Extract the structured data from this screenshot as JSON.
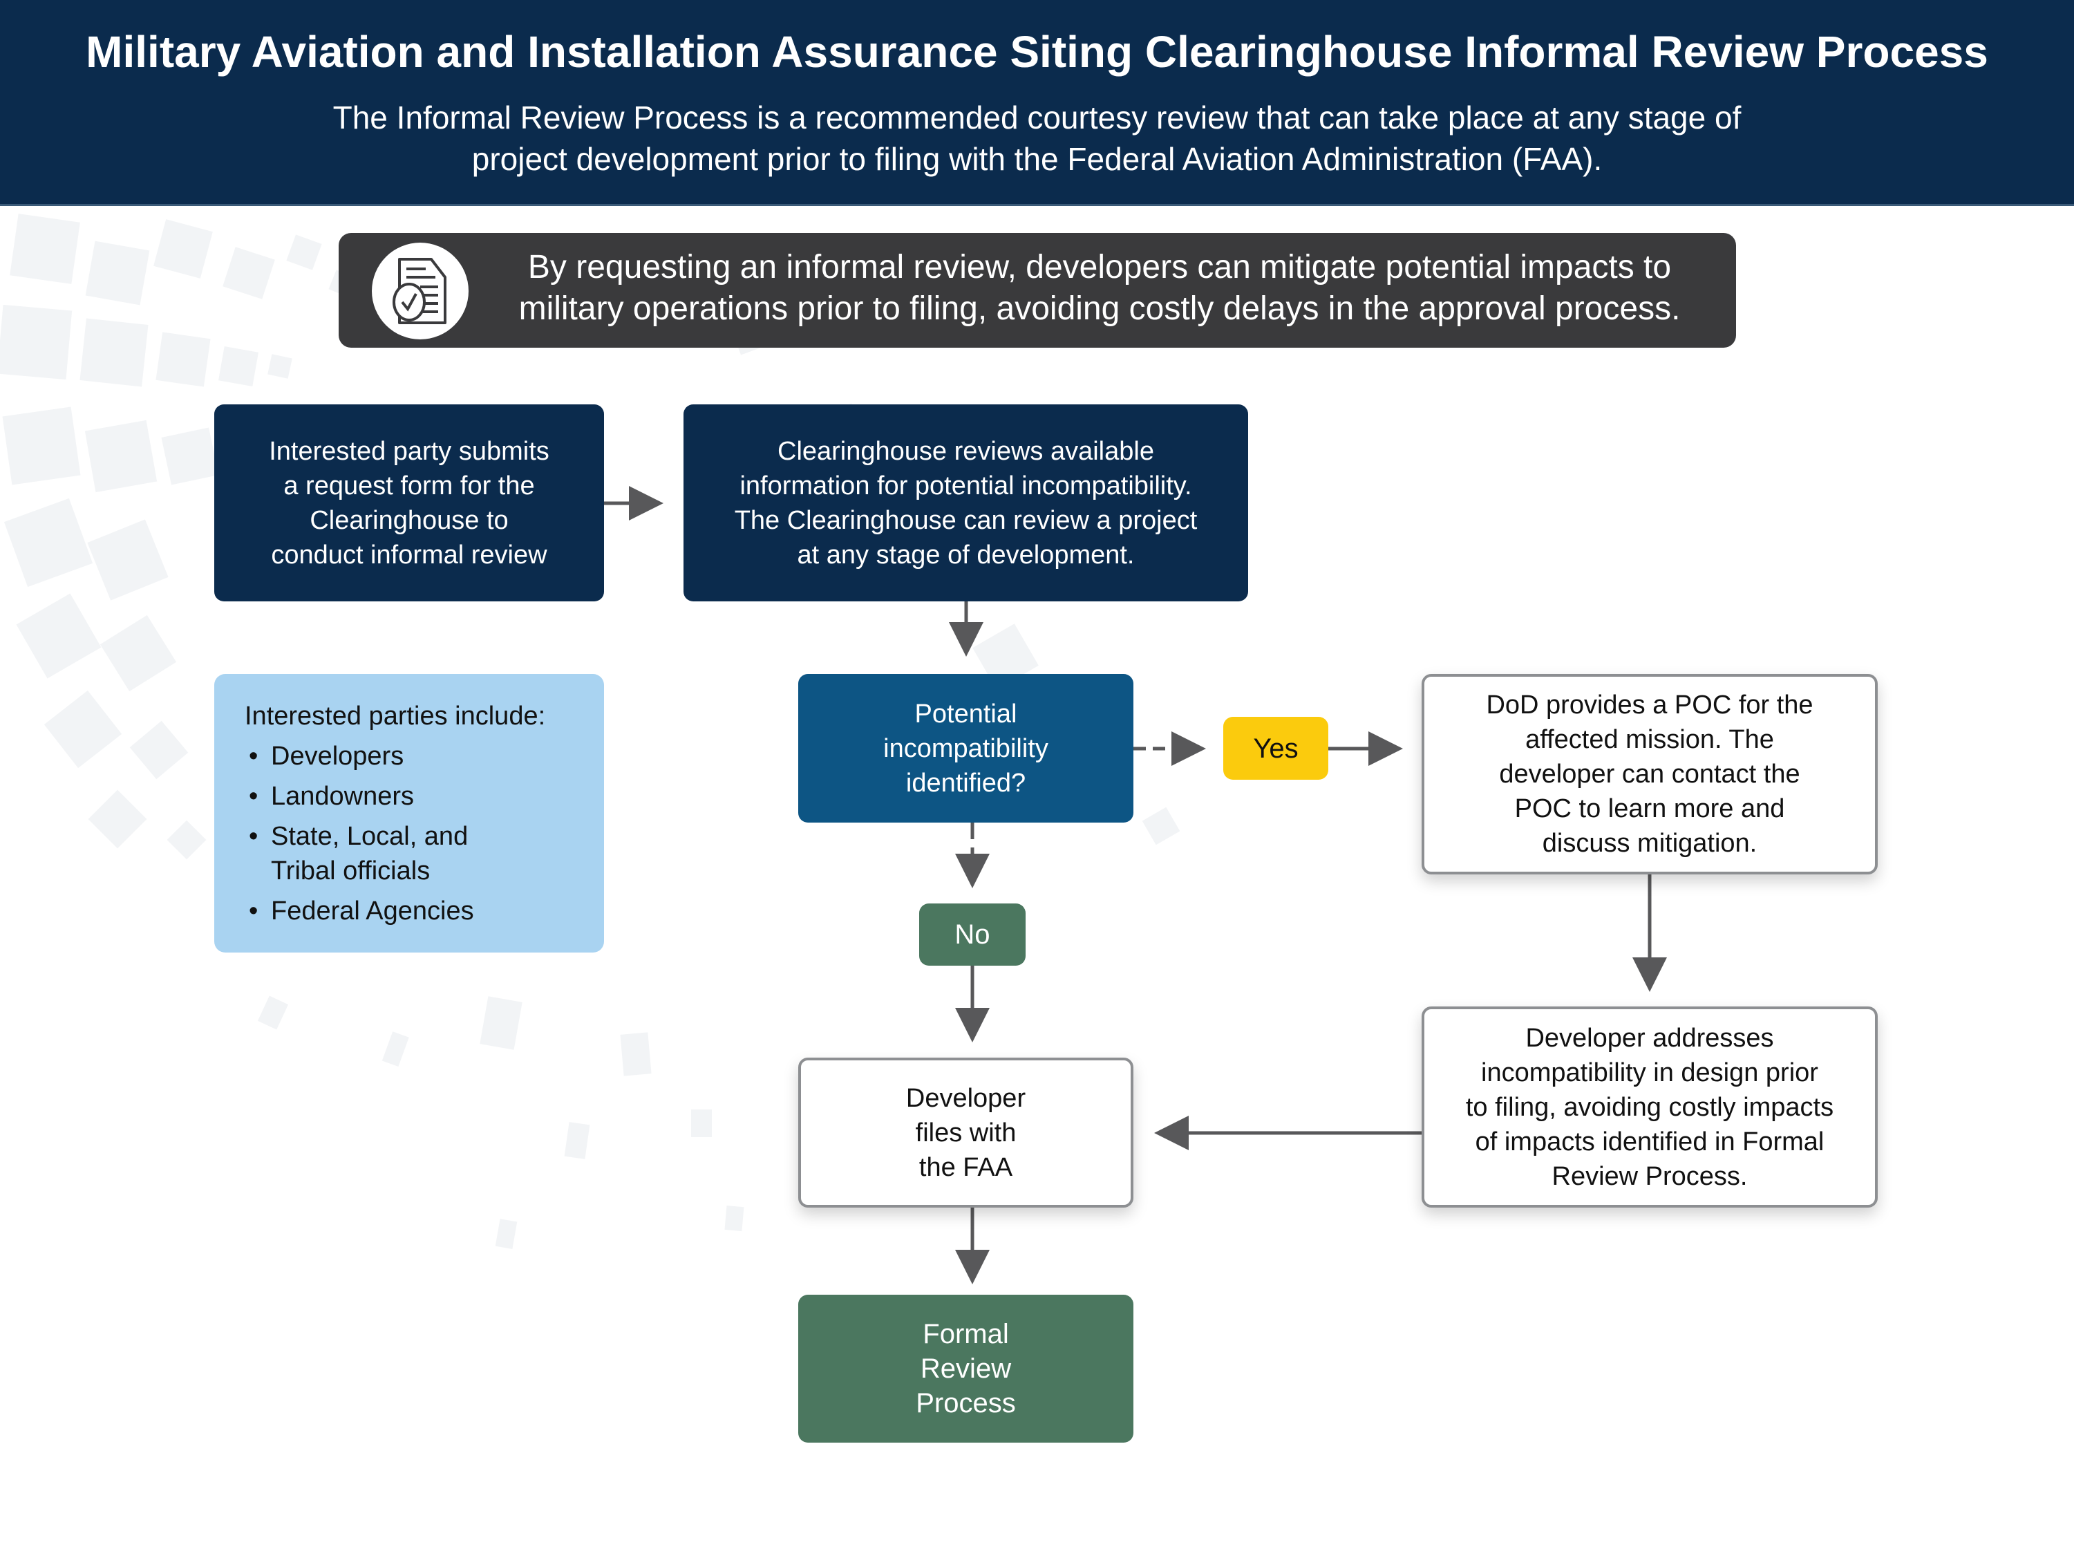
{
  "header": {
    "title": "Military Aviation and Installation Assurance Siting Clearinghouse Informal Review Process",
    "subtitle_line1": "The Informal Review Process is a recommended courtesy review that can take place at any stage of",
    "subtitle_line2": "project development prior to filing with the Federal Aviation Administration (FAA)."
  },
  "callout": {
    "icon": "document-checkmark-icon",
    "line1": "By requesting an informal review, developers can mitigate potential impacts to",
    "line2": "military operations prior to filing, avoiding costly delays in the approval process."
  },
  "flow": {
    "submit_request": [
      "Interested party submits",
      "a request form for the",
      "Clearinghouse to",
      "conduct informal review"
    ],
    "clearinghouse_reviews": [
      "Clearinghouse reviews available",
      "information for potential incompatibility.",
      "The Clearinghouse can review a project",
      "at any stage of development."
    ],
    "interested_parties": {
      "heading": "Interested parties include:",
      "items": [
        {
          "line1": "Developers"
        },
        {
          "line1": "Landowners"
        },
        {
          "line1": "State, Local, and",
          "line2": "Tribal officials"
        },
        {
          "line1": "Federal Agencies"
        }
      ],
      "bullet": "•"
    },
    "decision": [
      "Potential",
      "incompatibility",
      "identified?"
    ],
    "yes_label": "Yes",
    "no_label": "No",
    "dod_poc": [
      "DoD provides a POC for the",
      "affected mission. The",
      "developer can contact the",
      "POC to learn more and",
      "discuss mitigation."
    ],
    "developer_addresses": [
      "Developer addresses",
      "incompatibility in design prior",
      "to filing, avoiding costly impacts",
      "of impacts identified in Formal",
      "Review Process."
    ],
    "developer_files": [
      "Developer",
      "files with",
      "the FAA"
    ],
    "formal_review": [
      "Formal",
      "Review",
      "Process"
    ]
  },
  "colors": {
    "header_navy": "#0b2b4d",
    "callout_gray": "#3a3a3c",
    "decision_blue": "#0d5584",
    "light_blue": "#a9d3f1",
    "yes_yellow": "#fbcb0d",
    "green": "#4b775f",
    "arrow_gray": "#58585a"
  }
}
